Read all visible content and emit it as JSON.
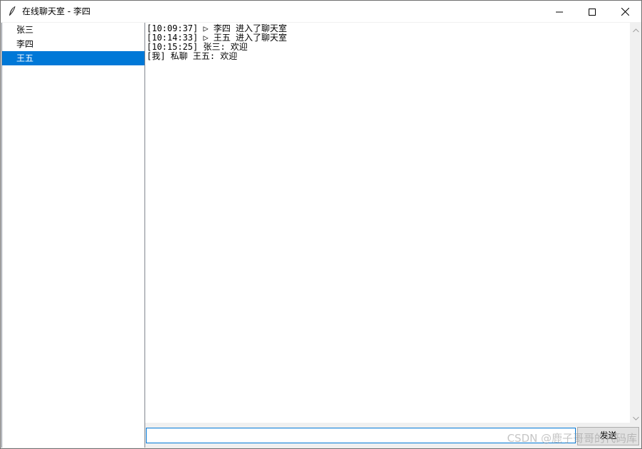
{
  "window": {
    "title": "在线聊天室 - 李四",
    "icon": "feather-icon"
  },
  "window_controls": {
    "minimize_icon": "minimize-icon",
    "maximize_icon": "maximize-icon",
    "close_icon": "close-icon"
  },
  "users": {
    "items": [
      {
        "name": "张三",
        "selected": false
      },
      {
        "name": "李四",
        "selected": false
      },
      {
        "name": "王五",
        "selected": true
      }
    ]
  },
  "messages": [
    "[10:09:37] ▷ 李四 进入了聊天室",
    "[10:14:33] ▷ 王五 进入了聊天室",
    "[10:15:25] 张三: 欢迎",
    "[我] 私聊 王五: 欢迎"
  ],
  "composer": {
    "input_value": "",
    "send_label": "发送"
  },
  "watermark": "CSDN @鹿子哥哥的代码库",
  "colors": {
    "selection": "#0078d7",
    "input_border": "#0078d7"
  }
}
